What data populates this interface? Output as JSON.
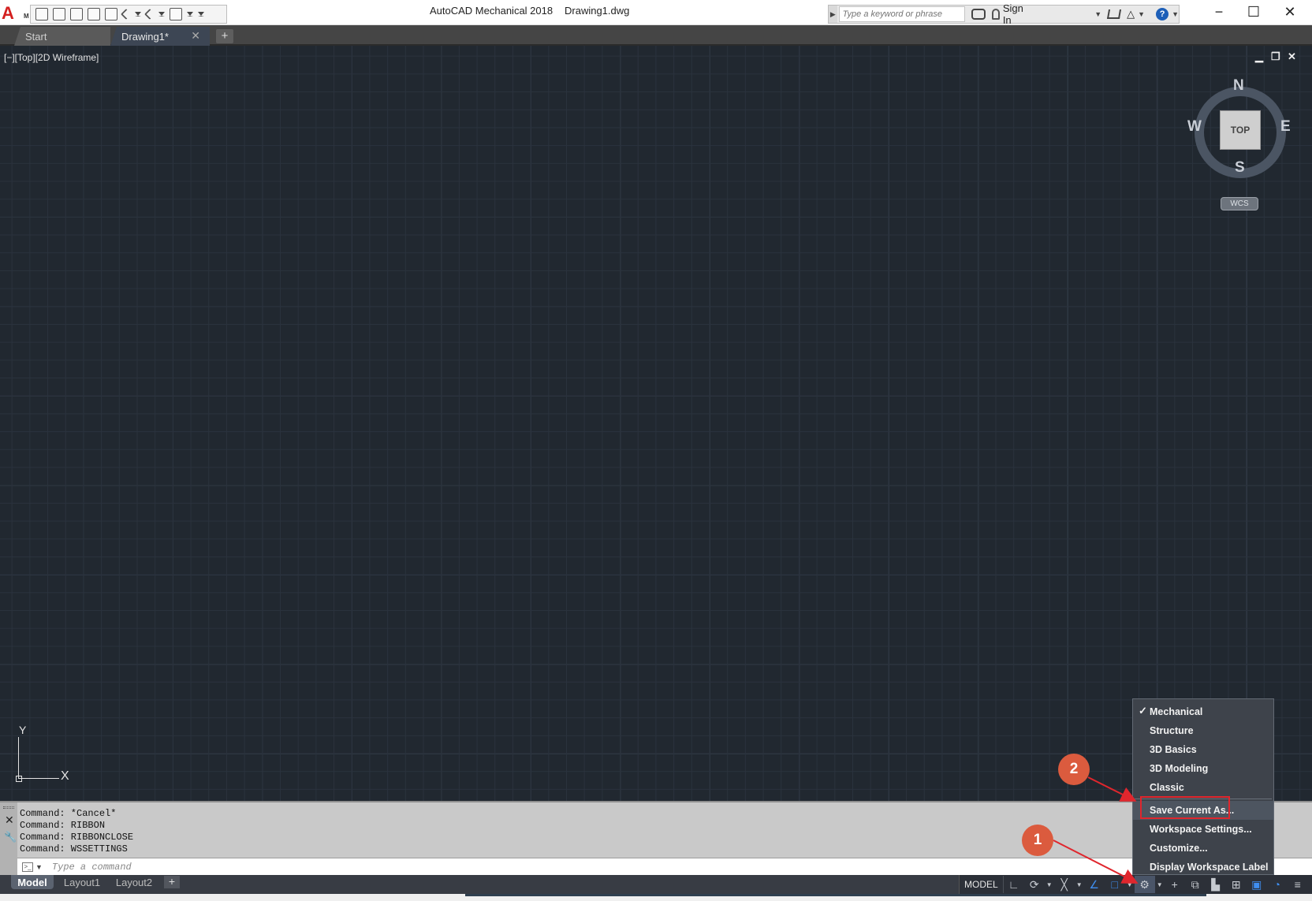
{
  "titlebar": {
    "app_title": "AutoCAD Mechanical 2018",
    "file_name": "Drawing1.dwg",
    "logo_letter": "A",
    "logo_sub": "M",
    "search_placeholder": "Type a keyword or phrase",
    "sign_in": "Sign In"
  },
  "file_tabs": [
    {
      "label": "Start"
    },
    {
      "label": "Drawing1*"
    }
  ],
  "viewport": {
    "label": "[−][Top][2D Wireframe]",
    "viewcube": {
      "face": "TOP",
      "north": "N",
      "south": "S",
      "east": "E",
      "west": "W"
    },
    "wcs": "WCS",
    "ucs": {
      "x": "X",
      "y": "Y"
    }
  },
  "command": {
    "history": [
      "Command: *Cancel*",
      "Command: RIBBON",
      "Command: RIBBONCLOSE",
      "Command: WSSETTINGS"
    ],
    "placeholder": "Type a command"
  },
  "layout_tabs": [
    {
      "label": "Model",
      "active": true
    },
    {
      "label": "Layout1",
      "active": false
    },
    {
      "label": "Layout2",
      "active": false
    }
  ],
  "status": {
    "model": "MODEL"
  },
  "workspace_menu": {
    "items": [
      {
        "label": "Mechanical",
        "checked": true
      },
      {
        "label": "Structure",
        "checked": false
      },
      {
        "label": "3D Basics",
        "checked": false
      },
      {
        "label": "3D Modeling",
        "checked": false
      },
      {
        "label": "Classic",
        "checked": false
      }
    ],
    "actions": [
      {
        "label": "Save Current As..."
      },
      {
        "label": "Workspace Settings..."
      },
      {
        "label": "Customize..."
      },
      {
        "label": "Display Workspace Label"
      }
    ],
    "check_glyph": "✓"
  },
  "annotations": {
    "step1": "1",
    "step2": "2",
    "color": "#e0262d"
  },
  "colors": {
    "canvas": "#212830",
    "accent_blue": "#3f8ef0"
  }
}
